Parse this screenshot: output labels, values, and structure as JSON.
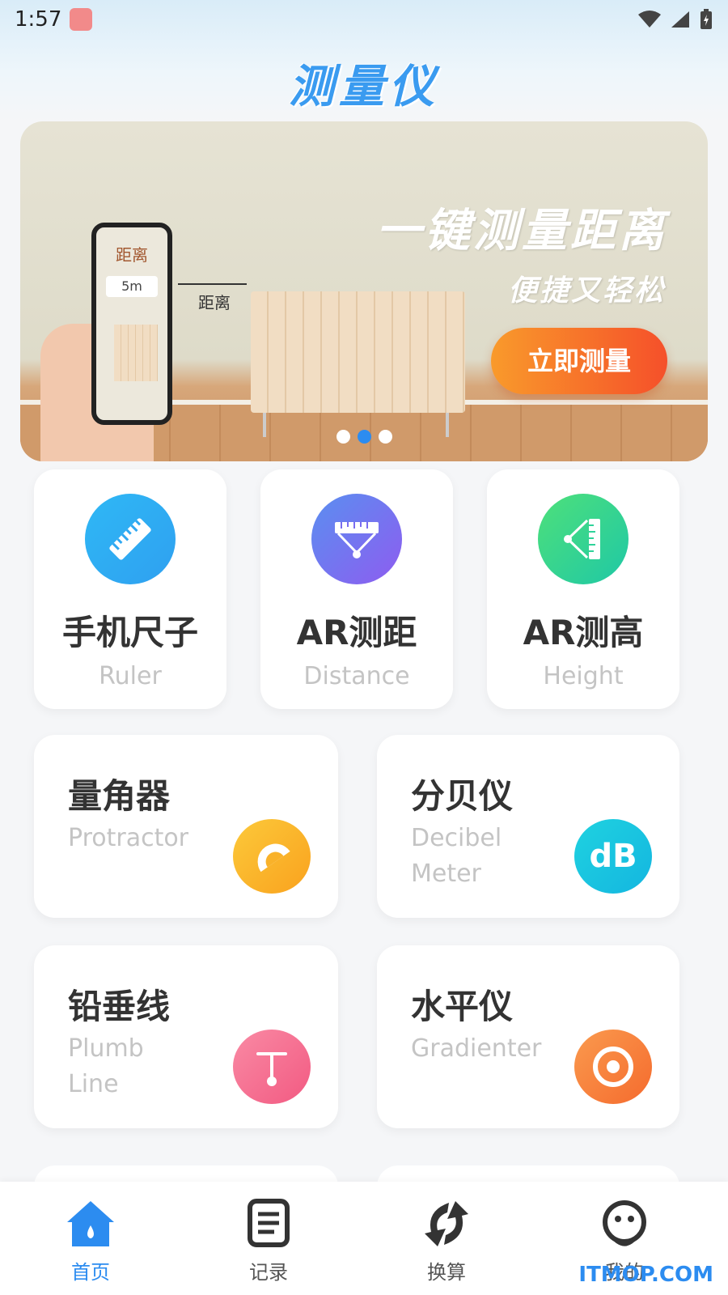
{
  "status_bar": {
    "time": "1:57"
  },
  "header": {
    "title": "测量仪"
  },
  "banner": {
    "headline": "一键测量距离",
    "subheadline": "便捷又轻松",
    "cta_label": "立即测量",
    "phone_label": "距离",
    "phone_value": "5m",
    "distance_label": "距离",
    "active_slide": 2,
    "slide_count": 3
  },
  "tools_top": [
    {
      "title": "手机尺子",
      "subtitle": "Ruler",
      "icon": "ruler-icon",
      "color": "#2fb8f5"
    },
    {
      "title": "AR测距",
      "subtitle": "Distance",
      "icon": "distance-icon",
      "color": "#7a6cf0"
    },
    {
      "title": "AR测高",
      "subtitle": "Height",
      "icon": "height-icon",
      "color": "#2fd39a"
    }
  ],
  "tools_grid": [
    {
      "title": "量角器",
      "subtitle": "Protractor",
      "icon": "protractor-icon",
      "color": "#fbb62c"
    },
    {
      "title": "分贝仪",
      "subtitle": "Decibel Meter",
      "subtitle_line1": "Decibel",
      "subtitle_line2": "Meter",
      "icon_text": "dB",
      "icon": "decibel-icon",
      "color": "#19c6e0"
    },
    {
      "title": "铅垂线",
      "subtitle": "Plumb Line",
      "subtitle_line1": "Plumb",
      "subtitle_line2": "Line",
      "icon": "plumb-line-icon",
      "color": "#f56c8d"
    },
    {
      "title": "水平仪",
      "subtitle": "Gradienter",
      "icon": "gradienter-icon",
      "color": "#f5813a"
    }
  ],
  "bottom_nav": [
    {
      "label": "首页",
      "icon": "home-icon",
      "active": true
    },
    {
      "label": "记录",
      "icon": "records-icon",
      "active": false
    },
    {
      "label": "换算",
      "icon": "convert-icon",
      "active": false
    },
    {
      "label": "我的",
      "icon": "profile-icon",
      "active": false
    }
  ],
  "watermark": "ITMOP.COM"
}
